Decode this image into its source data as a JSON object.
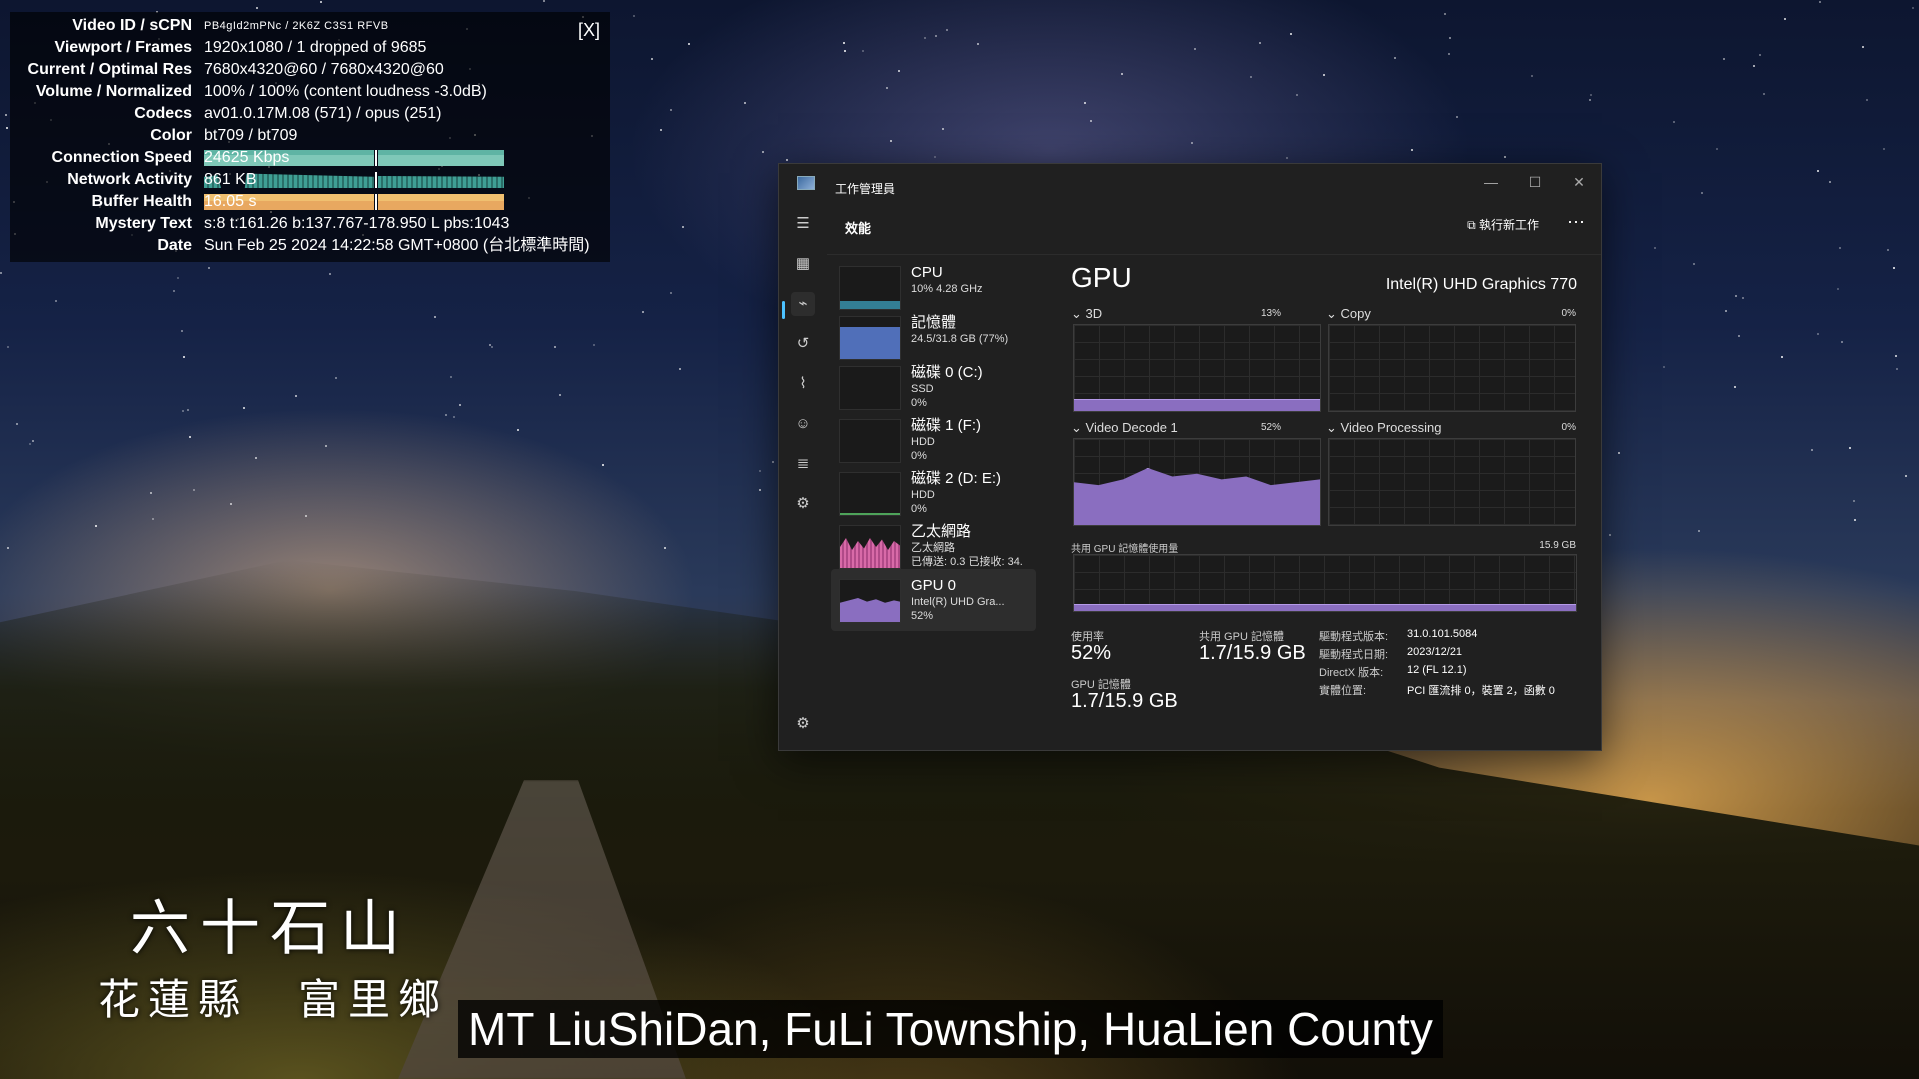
{
  "stats": {
    "close": "[X]",
    "rows": [
      {
        "label": "Video ID / sCPN",
        "value": "PB4gId2mPNc  /  2K6Z  C3S1  RFVB"
      },
      {
        "label": "Viewport / Frames",
        "value": "1920x1080 / 1 dropped of 9685"
      },
      {
        "label": "Current / Optimal Res",
        "value": "7680x4320@60 / 7680x4320@60"
      },
      {
        "label": "Volume / Normalized",
        "value": "100% / 100% (content loudness -3.0dB)"
      },
      {
        "label": "Codecs",
        "value": "av01.0.17M.08 (571) / opus (251)"
      },
      {
        "label": "Color",
        "value": "bt709 / bt709"
      },
      {
        "label": "Connection Speed",
        "value": "24625 Kbps"
      },
      {
        "label": "Network Activity",
        "value": "861 KB"
      },
      {
        "label": "Buffer Health",
        "value": "16.05 s"
      },
      {
        "label": "Mystery Text",
        "value": "s:8 t:161.26 b:137.767-178.950 L pbs:1043"
      },
      {
        "label": "Date",
        "value": "Sun Feb 25 2024 14:22:58 GMT+0800 (台北標準時間)"
      }
    ],
    "colors": {
      "connection": "#5fb4a4",
      "network": "#3f9e94",
      "buffer": "#e8a860"
    }
  },
  "taskmgr": {
    "title": "工作管理員",
    "window_buttons": {
      "minimize": "—",
      "maximize": "☐",
      "close": "✕"
    },
    "section": "效能",
    "run_new_task": "執行新工作",
    "more": "⋯",
    "rail_icons": [
      "menu-icon",
      "processes-icon",
      "performance-icon",
      "app-history-icon",
      "startup-icon",
      "users-icon",
      "details-icon",
      "services-icon",
      "settings-icon"
    ],
    "items": [
      {
        "name": "CPU",
        "sub1": "10% 4.28 GHz",
        "sub2": "",
        "sub3": "",
        "color": "#3fa9c9",
        "level": 0.1
      },
      {
        "name": "記憶體",
        "sub1": "24.5/31.8 GB (77%)",
        "sub2": "",
        "sub3": "",
        "color": "#5b7fd6",
        "level": 0.77
      },
      {
        "name": "磁碟 0 (C:)",
        "sub1": "SSD",
        "sub2": "0%",
        "sub3": "",
        "color": "#4ea35a",
        "level": 0
      },
      {
        "name": "磁碟 1 (F:)",
        "sub1": "HDD",
        "sub2": "0%",
        "sub3": "",
        "color": "#4ea35a",
        "level": 0
      },
      {
        "name": "磁碟 2 (D: E:)",
        "sub1": "HDD",
        "sub2": "0%",
        "sub3": "",
        "color": "#4ea35a",
        "level": 0.02
      },
      {
        "name": "乙太網路",
        "sub1": "乙太網路",
        "sub2": "已傳送: 0.3 已接收: 34.",
        "sub3": "",
        "color": "#d86aa8",
        "level": 0.6
      },
      {
        "name": "GPU 0",
        "sub1": "Intel(R) UHD Gra...",
        "sub2": "52%",
        "sub3": "",
        "color": "#8a6ec0",
        "level": 0.52
      }
    ],
    "gpu": {
      "heading": "GPU",
      "model": "Intel(R) UHD Graphics 770",
      "engines": [
        {
          "label": "3D",
          "pct": "13%",
          "level": 0.13
        },
        {
          "label": "Copy",
          "pct": "0%",
          "level": 0
        },
        {
          "label": "Video Decode 1",
          "pct": "52%",
          "level": 0.52
        },
        {
          "label": "Video Processing",
          "pct": "0%",
          "level": 0
        }
      ],
      "shared_label": "共用 GPU 記憶體使用量",
      "shared_max": "15.9 GB",
      "shared_level": 0.107,
      "usage_label": "使用率",
      "usage_value": "52%",
      "shared_mem_label": "共用 GPU 記憶體",
      "shared_mem_value": "1.7/15.9 GB",
      "gpu_mem_label": "GPU 記憶體",
      "gpu_mem_value": "1.7/15.9 GB",
      "details": [
        {
          "label": "驅動程式版本:",
          "value": "31.0.101.5084"
        },
        {
          "label": "驅動程式日期:",
          "value": "2023/12/21"
        },
        {
          "label": "DirectX 版本:",
          "value": "12 (FL 12.1)"
        },
        {
          "label": "實體位置:",
          "value": "PCI 匯流排 0，裝置 2，函數 0"
        }
      ],
      "graph_color": "#8a6ec0"
    }
  },
  "captions": {
    "title_cn": "六十石山",
    "location_cn": "花蓮縣　富里鄉",
    "subtitle_en": "MT LiuShiDan, FuLi Township, HuaLien County"
  }
}
